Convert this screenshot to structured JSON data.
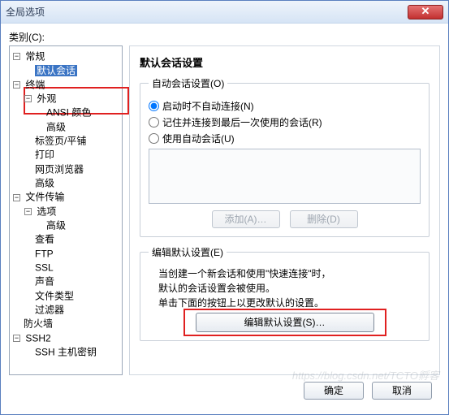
{
  "window": {
    "title": "全局选项",
    "close_glyph": "✕"
  },
  "category_label": "类别(C):",
  "tree": {
    "general": "常规",
    "default_session": "默认会话",
    "terminal": "终端",
    "appearance": "外观",
    "ansi_color": "ANSI 颜色",
    "advanced": "高级",
    "tab_tile": "标签页/平铺",
    "print": "打印",
    "web_browser": "网页浏览器",
    "advanced2": "高级",
    "file_transfer": "文件传输",
    "options": "选项",
    "advanced3": "高级",
    "view": "查看",
    "ftp": "FTP",
    "ssl": "SSL",
    "sound": "声音",
    "file_types": "文件类型",
    "filters": "过滤器",
    "firewall": "防火墙",
    "ssh2": "SSH2",
    "ssh_host_key": "SSH 主机密钥"
  },
  "toggle": {
    "minus": "−",
    "plus": "+"
  },
  "right": {
    "title": "默认会话设置",
    "auto_group": "自动会话设置(O)",
    "radio_no_auto": "启动时不自动连接(N)",
    "radio_remember": "记住并连接到最后一次使用的会话(R)",
    "radio_use_auto": "使用自动会话(U)",
    "add_btn": "添加(A)…",
    "del_btn": "删除(D)",
    "edit_group": "编辑默认设置(E)",
    "desc1": "当创建一个新会话和使用\"快速连接\"时，",
    "desc2": "默认的会话设置会被使用。",
    "desc3": "单击下面的按钮上以更改默认的设置。",
    "edit_btn": "编辑默认设置(S)…"
  },
  "footer": {
    "ok": "确定",
    "cancel": "取消"
  },
  "watermark": "https://blog.csdn.net/TCTO孵客"
}
